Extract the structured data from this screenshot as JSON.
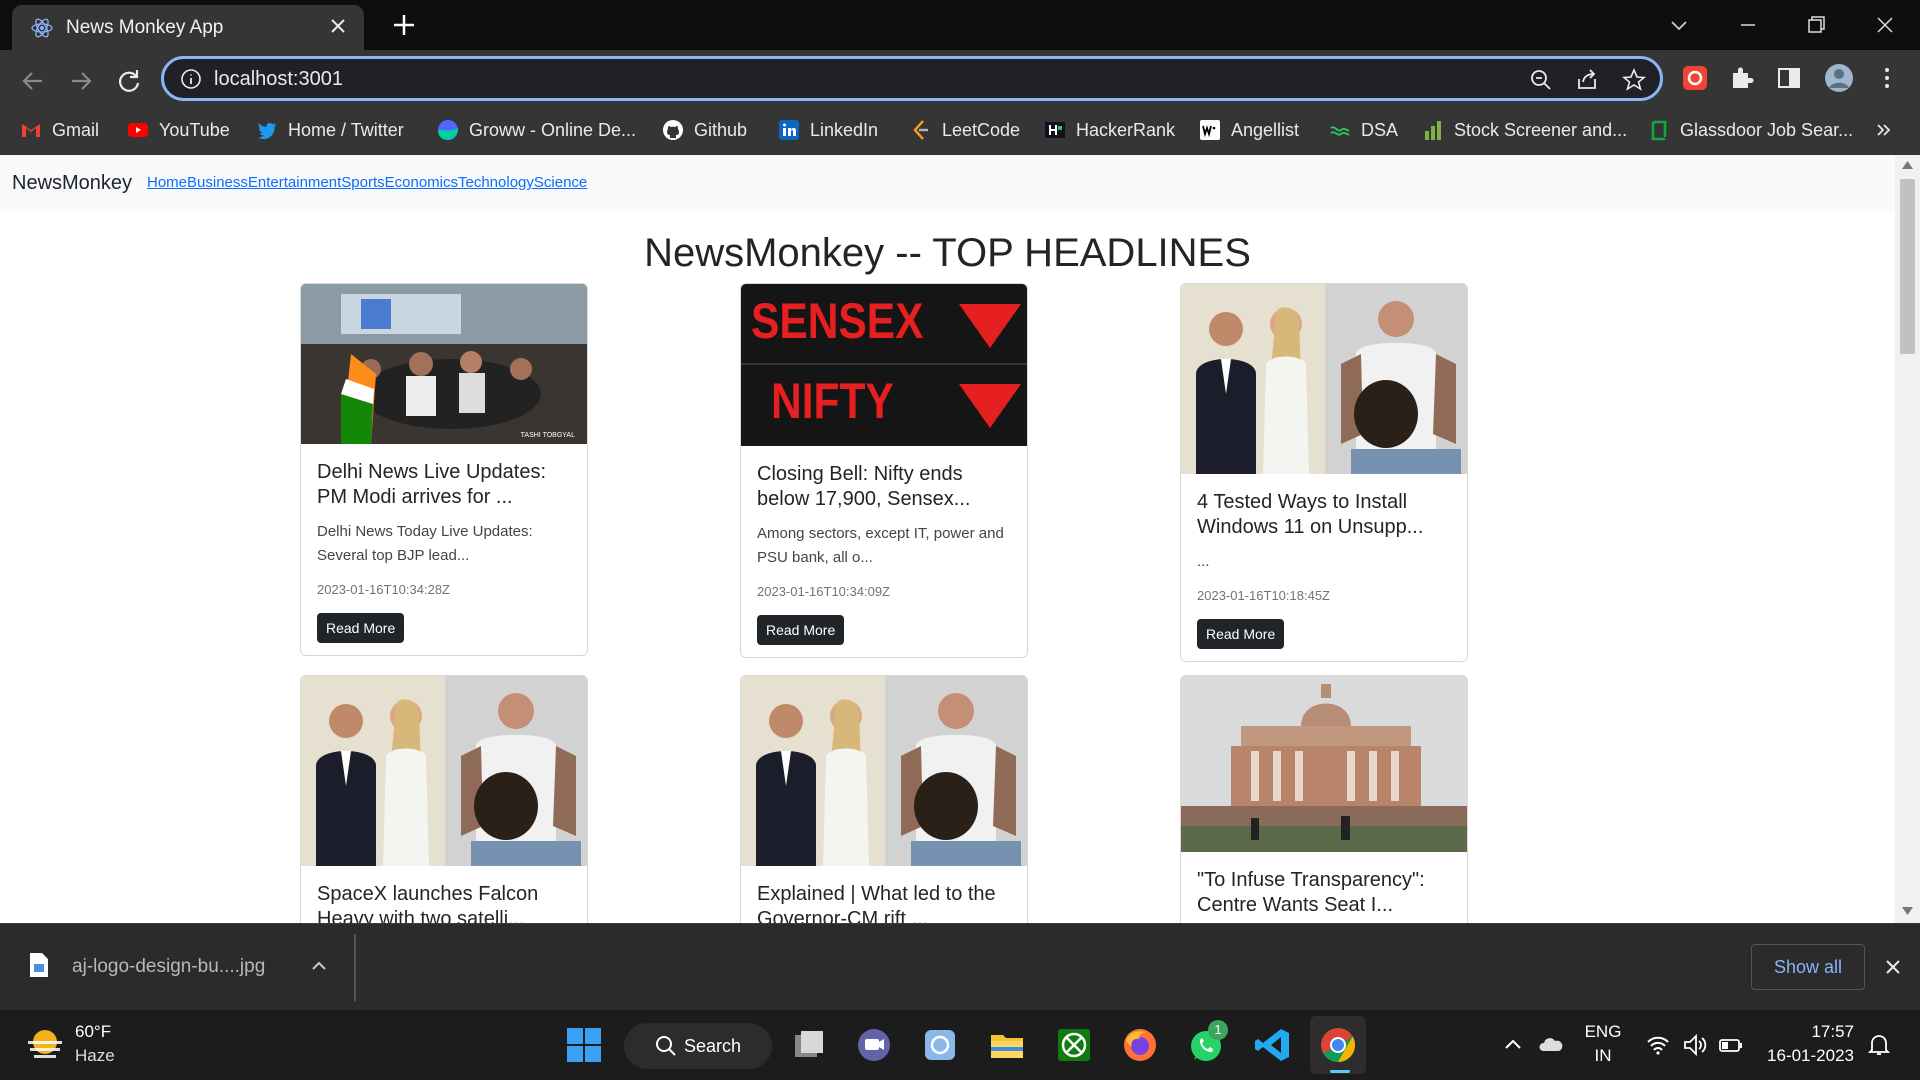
{
  "browser": {
    "tab_title": "News Monkey App",
    "url": "localhost:3001"
  },
  "bookmarks": [
    {
      "label": "Gmail",
      "icon": "gmail-icon",
      "color": "#ea4335"
    },
    {
      "label": "YouTube",
      "icon": "youtube-icon",
      "color": "#ff0000"
    },
    {
      "label": "Home / Twitter",
      "icon": "twitter-icon",
      "color": "#1d9bf0"
    },
    {
      "label": "Groww - Online De...",
      "icon": "groww-icon",
      "color": "#5367ff"
    },
    {
      "label": "Github",
      "icon": "github-icon",
      "color": "#ffffff"
    },
    {
      "label": "LinkedIn",
      "icon": "linkedin-icon",
      "color": "#0a66c2"
    },
    {
      "label": "LeetCode",
      "icon": "leetcode-icon",
      "color": "#ffa116"
    },
    {
      "label": "HackerRank",
      "icon": "hackerrank-icon",
      "color": "#2ec866"
    },
    {
      "label": "Angellist",
      "icon": "angellist-icon",
      "color": "#ffffff"
    },
    {
      "label": "DSA",
      "icon": "dsa-icon",
      "color": "#2ec866"
    },
    {
      "label": "Stock Screener and...",
      "icon": "stock-screener-icon",
      "color": "#7cb342"
    },
    {
      "label": "Glassdoor Job Sear...",
      "icon": "glassdoor-icon",
      "color": "#0caa41"
    }
  ],
  "navbar": {
    "brand": "NewsMonkey",
    "links": [
      "Home",
      "Business",
      "Entertainment",
      "Sports",
      "Economics",
      "Technology",
      "Science"
    ]
  },
  "page": {
    "heading": "NewsMonkey -- TOP HEADLINES",
    "read_more": "Read More"
  },
  "cards": [
    {
      "title": "Delhi News Live Updates: PM Modi arrives for ...",
      "description": "Delhi News Today Live Updates: Several top BJP lead...",
      "date": "2023-01-16T10:34:28Z",
      "image": "crowd"
    },
    {
      "title": "Closing Bell: Nifty ends below 17,900, Sensex...",
      "description": "Among sectors, except IT, power and PSU bank, all o...",
      "date": "2023-01-16T10:34:09Z",
      "image": "sensex"
    },
    {
      "title": "4 Tested Ways to Install Windows 11 on Unsupp...",
      "description": "...",
      "date": "2023-01-16T10:18:45Z",
      "image": "people"
    },
    {
      "title": "SpaceX launches Falcon Heavy with two satelli...",
      "description": "",
      "date": "",
      "image": "people"
    },
    {
      "title": "Explained | What led to the Governor-CM rift ...",
      "description": "",
      "date": "",
      "image": "people"
    },
    {
      "title": "\"To Infuse Transparency\": Centre Wants Seat I...",
      "description": "",
      "date": "",
      "image": "court"
    }
  ],
  "image_text": {
    "sensex": "SENSEX",
    "nifty": "NIFTY",
    "credit": "TASHI TOBGYAL"
  },
  "downloads": {
    "file_name": "aj-logo-design-bu....jpg",
    "show_all": "Show all"
  },
  "taskbar": {
    "temperature": "60°F",
    "weather": "Haze",
    "search": "Search",
    "lang_top": "ENG",
    "lang_bottom": "IN",
    "time": "17:57",
    "date": "16-01-2023",
    "whatsapp_badge": "1"
  }
}
